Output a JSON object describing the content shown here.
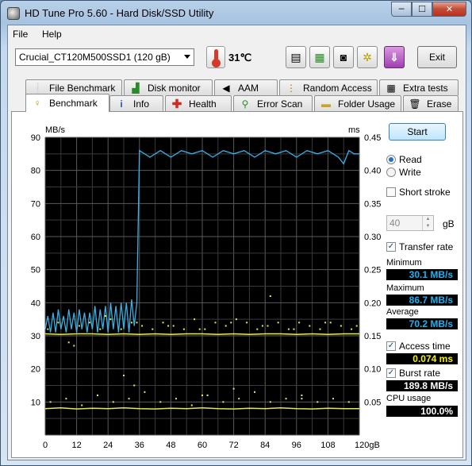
{
  "window": {
    "title": "HD Tune Pro 5.60 - Hard Disk/SSD Utility",
    "min": "─",
    "max": "☐",
    "close": "✕"
  },
  "menu": {
    "file": "File",
    "help": "Help"
  },
  "toolbar": {
    "drive": "Crucial_CT120M500SSD1 (120 gB)",
    "temperature": "31℃",
    "exit": "Exit"
  },
  "tabs_back": [
    {
      "label": "File Benchmark",
      "icon": "file-benchmark-icon"
    },
    {
      "label": "Disk monitor",
      "icon": "disk-monitor-icon"
    },
    {
      "label": "AAM",
      "icon": "speaker-icon"
    },
    {
      "label": "Random Access",
      "icon": "random-access-icon"
    },
    {
      "label": "Extra tests",
      "icon": "extra-tests-icon"
    }
  ],
  "tabs_front": [
    {
      "label": "Benchmark",
      "icon": "benchmark-icon"
    },
    {
      "label": "Info",
      "icon": "info-icon"
    },
    {
      "label": "Health",
      "icon": "health-cross-icon"
    },
    {
      "label": "Error Scan",
      "icon": "magnifier-icon"
    },
    {
      "label": "Folder Usage",
      "icon": "folder-icon"
    },
    {
      "label": "Erase",
      "icon": "trash-icon"
    }
  ],
  "controls": {
    "start": "Start",
    "read": "Read",
    "write": "Write",
    "short_stroke": "Short stroke",
    "short_stroke_value": "40",
    "gb": "gB",
    "transfer_rate": "Transfer rate",
    "minimum_label": "Minimum",
    "minimum": "30.1 MB/s",
    "maximum_label": "Maximum",
    "maximum": "86.7 MB/s",
    "average_label": "Average",
    "average": "70.2 MB/s",
    "access_time_label": "Access time",
    "access_time": "0.074 ms",
    "burst_rate_label": "Burst rate",
    "burst_rate": "189.8 MB/s",
    "cpu_usage_label": "CPU usage",
    "cpu_usage": "100.0%"
  },
  "chart_data": {
    "type": "line",
    "y_left_label": "MB/s",
    "y_right_label": "ms",
    "x_unit_label": "gB",
    "x_ticks": [
      "0",
      "12",
      "24",
      "36",
      "48",
      "60",
      "72",
      "84",
      "96",
      "108",
      "120gB"
    ],
    "y_left_ticks": [
      "90",
      "80",
      "70",
      "60",
      "50",
      "40",
      "30",
      "20",
      "10"
    ],
    "y_right_ticks": [
      "0.45",
      "0.40",
      "0.35",
      "0.30",
      "0.25",
      "0.20",
      "0.15",
      "0.10",
      "0.05"
    ],
    "xlim": [
      0,
      120
    ],
    "ylim_left": [
      0,
      90
    ],
    "ylim_right": [
      0,
      0.45
    ],
    "grid": true,
    "series": [
      {
        "color": "#3ab0e6",
        "axis": "left",
        "x": [
          0,
          1,
          2,
          3,
          4,
          5,
          6,
          7,
          8,
          9,
          10,
          11,
          12,
          13,
          14,
          15,
          16,
          17,
          18,
          19,
          20,
          21,
          22,
          23,
          24,
          25,
          26,
          27,
          28,
          29,
          30,
          31,
          32,
          33,
          34,
          35,
          36,
          40,
          44,
          48,
          52,
          56,
          60,
          64,
          68,
          72,
          76,
          80,
          84,
          88,
          92,
          96,
          100,
          104,
          108,
          112,
          114,
          116,
          118,
          120
        ],
        "y": [
          32,
          36,
          31,
          37,
          31,
          38,
          32,
          36,
          31,
          38,
          32,
          37,
          31,
          38,
          32,
          37,
          31,
          37,
          32,
          39,
          31,
          38,
          32,
          39,
          31,
          40,
          32,
          39,
          31,
          40,
          32,
          40,
          31,
          41,
          33,
          40,
          86,
          84,
          86,
          84,
          86,
          85,
          86,
          84,
          86,
          85,
          86,
          84,
          86,
          85,
          86,
          84,
          86,
          85,
          86,
          84,
          82,
          86,
          85,
          85
        ]
      },
      {
        "color": "#e8e850",
        "axis": "right",
        "x": [
          0,
          6,
          12,
          18,
          24,
          30,
          36,
          42,
          48,
          54,
          60,
          66,
          72,
          78,
          84,
          90,
          96,
          102,
          108,
          114,
          120
        ],
        "y": [
          0.153,
          0.152,
          0.153,
          0.153,
          0.152,
          0.153,
          0.152,
          0.153,
          0.152,
          0.153,
          0.153,
          0.152,
          0.153,
          0.152,
          0.153,
          0.153,
          0.152,
          0.153,
          0.152,
          0.153,
          0.153
        ]
      },
      {
        "color": "#e8e850",
        "axis": "left",
        "x": [
          0,
          6,
          12,
          18,
          24,
          30,
          36,
          42,
          48,
          54,
          60,
          66,
          72,
          78,
          84,
          90,
          96,
          102,
          108,
          114,
          120
        ],
        "y": [
          8,
          8.2,
          7.9,
          8.1,
          8,
          8.2,
          8,
          7.9,
          8.1,
          8,
          8.2,
          8,
          7.9,
          8.1,
          8,
          8.2,
          8,
          7.9,
          8.1,
          8,
          8
        ]
      }
    ],
    "scatter_access": {
      "color": "#e8e850",
      "axis": "right",
      "x": [
        1,
        5,
        9,
        13,
        17,
        21,
        25,
        29,
        33,
        37,
        41,
        45,
        49,
        53,
        57,
        61,
        65,
        69,
        73,
        77,
        81,
        85,
        89,
        93,
        97,
        101,
        105,
        109,
        113,
        117,
        11,
        23,
        35,
        47,
        59,
        71,
        83,
        95,
        107,
        119,
        86
      ],
      "y": [
        0.16,
        0.17,
        0.14,
        0.165,
        0.17,
        0.16,
        0.175,
        0.16,
        0.17,
        0.165,
        0.16,
        0.17,
        0.165,
        0.16,
        0.175,
        0.16,
        0.17,
        0.165,
        0.175,
        0.17,
        0.16,
        0.165,
        0.17,
        0.16,
        0.17,
        0.165,
        0.16,
        0.17,
        0.165,
        0.16,
        0.135,
        0.18,
        0.17,
        0.165,
        0.16,
        0.17,
        0.165,
        0.16,
        0.17,
        0.165,
        0.21
      ]
    },
    "scatter_burst": {
      "color": "#e8e850",
      "axis": "left",
      "x": [
        2,
        8,
        14,
        20,
        26,
        32,
        38,
        44,
        50,
        56,
        62,
        68,
        74,
        80,
        86,
        92,
        98,
        104,
        110,
        116,
        30,
        34,
        60,
        72,
        98
      ],
      "y": [
        10,
        11,
        9,
        12,
        10,
        11,
        13,
        10,
        11,
        9,
        12,
        10,
        11,
        13,
        10,
        11,
        12,
        10,
        11,
        10,
        18,
        15,
        12,
        14,
        11
      ]
    }
  }
}
